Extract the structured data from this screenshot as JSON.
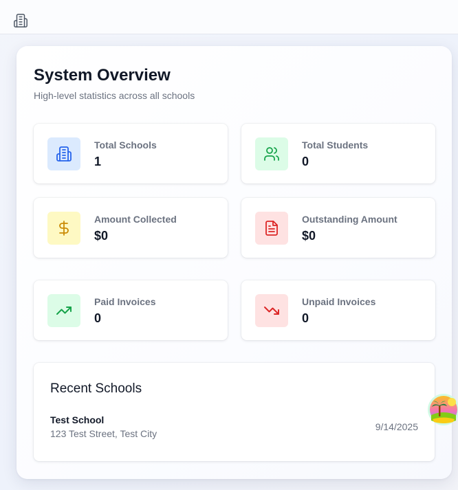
{
  "topbar": {
    "icon": "building-icon"
  },
  "overview": {
    "title": "System Overview",
    "subtitle": "High-level statistics across all schools"
  },
  "stats": [
    {
      "label": "Total Schools",
      "value": "1",
      "icon": "building-icon",
      "color": "#2563eb",
      "bg": "#dbeafe"
    },
    {
      "label": "Total Students",
      "value": "0",
      "icon": "users-icon",
      "color": "#16a34a",
      "bg": "#dcfce7"
    },
    {
      "label": "Amount Collected",
      "value": "$0",
      "icon": "dollar-icon",
      "color": "#ca8a04",
      "bg": "#fef9c3"
    },
    {
      "label": "Outstanding Amount",
      "value": "$0",
      "icon": "file-text-icon",
      "color": "#dc2626",
      "bg": "#fee2e2"
    },
    {
      "label": "Paid Invoices",
      "value": "0",
      "icon": "trending-up-icon",
      "color": "#16a34a",
      "bg": "#dcfce7"
    },
    {
      "label": "Unpaid Invoices",
      "value": "0",
      "icon": "trending-down-icon",
      "color": "#dc2626",
      "bg": "#fee2e2"
    }
  ],
  "recent": {
    "title": "Recent Schools",
    "schools": [
      {
        "name": "Test School",
        "address": "123 Test Street, Test City",
        "date": "9/14/2025"
      }
    ]
  },
  "floating_widget": {
    "icon": "beach-avatar-icon"
  }
}
